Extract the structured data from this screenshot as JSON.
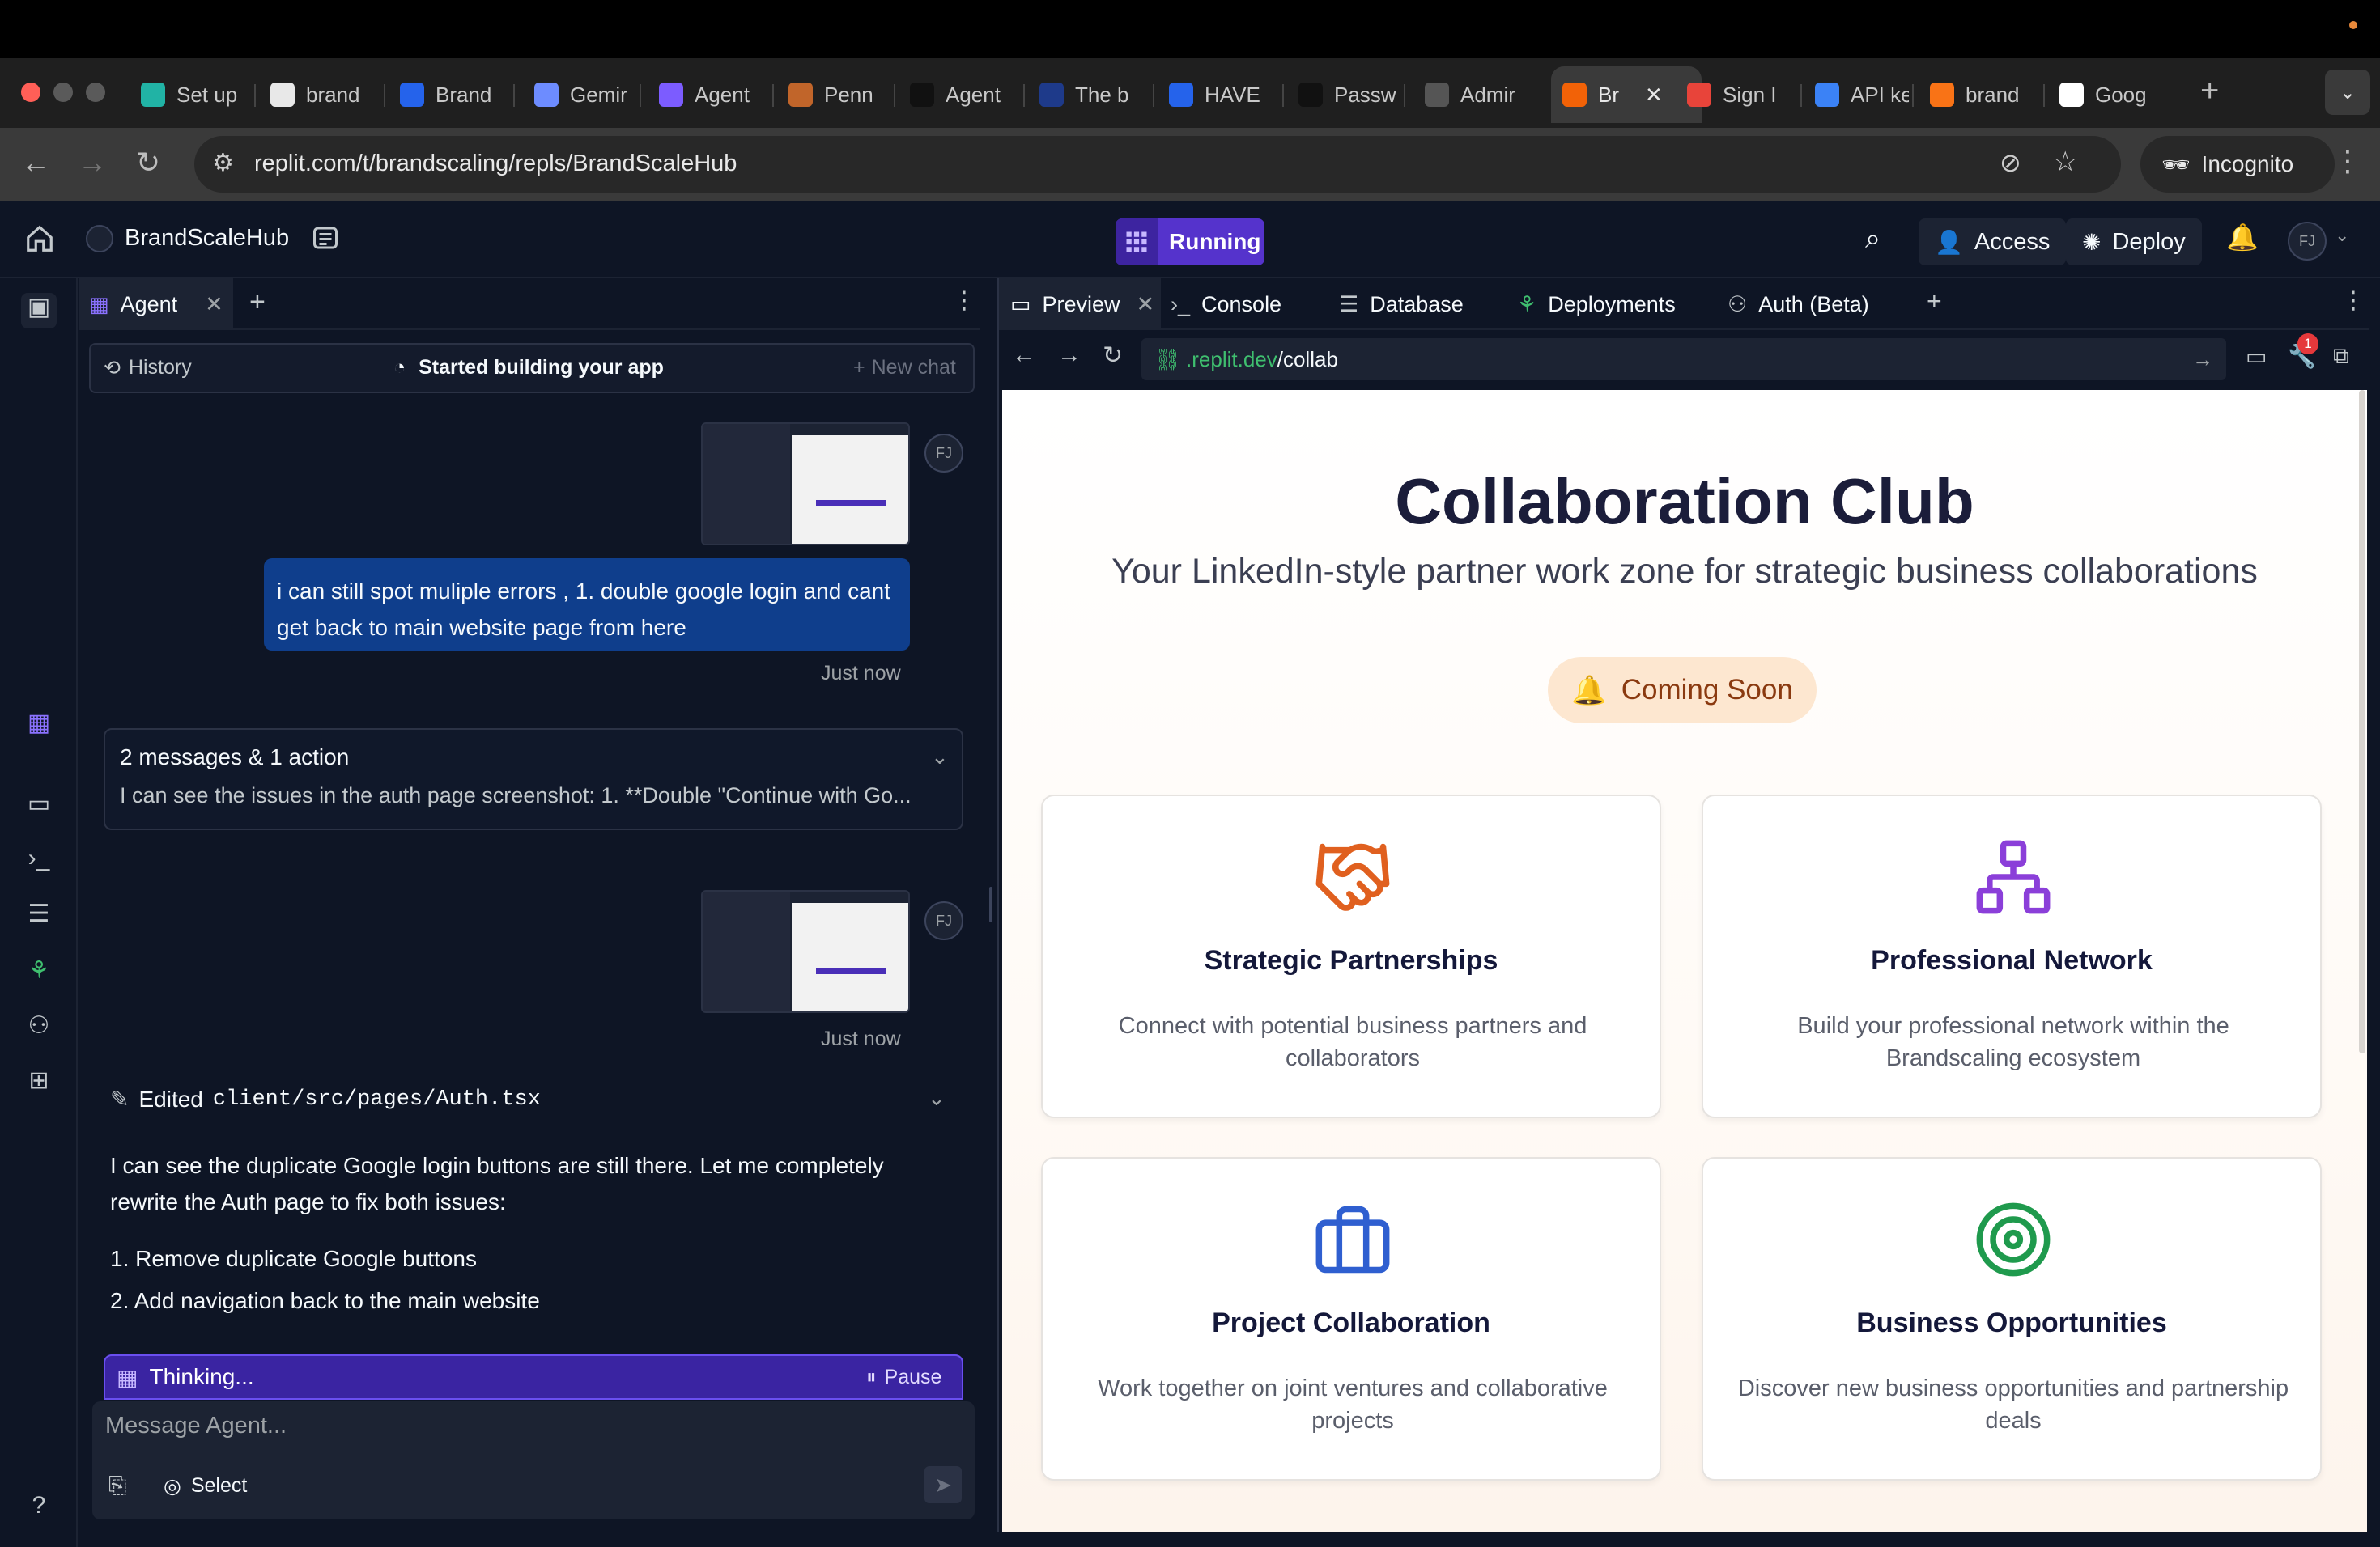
{
  "browser": {
    "tabs": [
      {
        "label": "Set up",
        "color": "#21b3a5"
      },
      {
        "label": "brand",
        "color": "#e8e8e8"
      },
      {
        "label": "Brand",
        "color": "#2563eb"
      },
      {
        "label": "Gemir",
        "color": "#6d8cff"
      },
      {
        "label": "Agent",
        "color": "#7c5cff"
      },
      {
        "label": "Penn",
        "color": "#c1652a"
      },
      {
        "label": "Agent",
        "color": "#111111"
      },
      {
        "label": "The b",
        "color": "#1e3a8a"
      },
      {
        "label": "HAVE",
        "color": "#2563eb"
      },
      {
        "label": "Passw",
        "color": "#111111"
      },
      {
        "label": "Admir",
        "color": "#555555"
      },
      {
        "label": "Br",
        "color": "#f26207"
      },
      {
        "label": "Sign I",
        "color": "#e8443a"
      },
      {
        "label": "API ke",
        "color": "#3b82f6"
      },
      {
        "label": "brand",
        "color": "#f97316"
      },
      {
        "label": "Goog",
        "color": "#ffffff"
      }
    ],
    "url": "replit.com/t/brandscaling/repls/BrandScaleHub",
    "incognito_label": "Incognito"
  },
  "header": {
    "project_name": "BrandScaleHub",
    "status": "Running",
    "access_label": "Access",
    "deploy_label": "Deploy",
    "user_initials": "FJ"
  },
  "agent": {
    "tab_label": "Agent",
    "history_label": "History",
    "status_label": "Started building your app",
    "new_chat_label": "New chat",
    "user_message": "i can still spot muliple errors , 1. double google login and cant get back to main website page from here",
    "timestamp1": "Just now",
    "timestamp2": "Just now",
    "summary_title": "2 messages & 1 action",
    "summary_text": "I can see the issues in the auth page screenshot: 1. **Double \"Continue with Go...",
    "edited_prefix": "Edited",
    "edited_file": "client/src/pages/Auth.tsx",
    "response_text": "I can see the duplicate Google login buttons are still there. Let me completely rewrite the Auth page to fix both issues:",
    "list": [
      "1. Remove duplicate Google buttons",
      "2. Add navigation back to the main website"
    ],
    "thinking_label": "Thinking...",
    "pause_label": "Pause",
    "composer_placeholder": "Message Agent...",
    "select_label": "Select"
  },
  "right_panel": {
    "tabs": [
      "Preview",
      "Console",
      "Database",
      "Deployments",
      "Auth (Beta)"
    ],
    "url_domain": ".replit.dev",
    "url_path": "/collab",
    "notification_count": "1"
  },
  "site": {
    "title": "Collaboration Club",
    "subtitle": "Your LinkedIn-style partner work zone for strategic business collaborations",
    "badge": "Coming Soon",
    "cards": [
      {
        "title": "Strategic Partnerships",
        "desc": "Connect with potential business partners and collaborators",
        "icon": "handshake-icon",
        "color": "#e0601f"
      },
      {
        "title": "Professional Network",
        "desc": "Build your professional network within the Brandscaling ecosystem",
        "icon": "network-icon",
        "color": "#8b3fd9"
      },
      {
        "title": "Project Collaboration",
        "desc": "Work together on joint ventures and collaborative projects",
        "icon": "briefcase-icon",
        "color": "#2f5fd0"
      },
      {
        "title": "Business Opportunities",
        "desc": "Discover new business opportunities and partnership deals",
        "icon": "target-icon",
        "color": "#1f9a4d"
      }
    ]
  }
}
